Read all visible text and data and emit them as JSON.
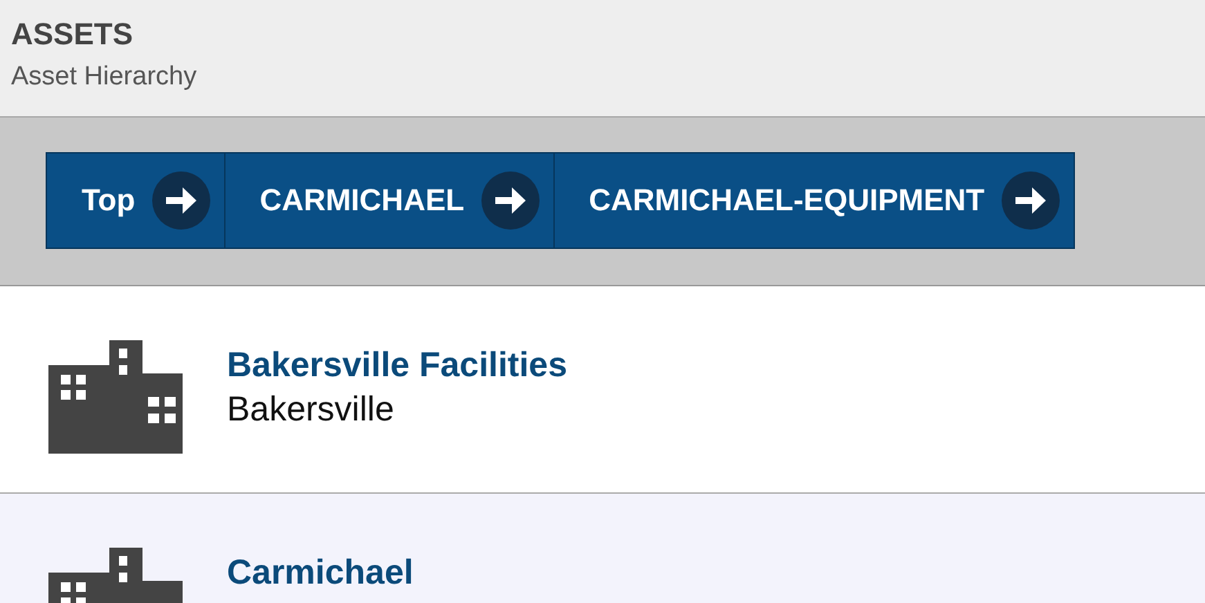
{
  "header": {
    "title": "ASSETS",
    "subtitle": "Asset Hierarchy"
  },
  "breadcrumb": [
    {
      "label": "Top"
    },
    {
      "label": "CARMICHAEL"
    },
    {
      "label": "CARMICHAEL-EQUIPMENT"
    }
  ],
  "assets": [
    {
      "name": "Bakersville Facilities",
      "location": "Bakersville",
      "selected": false
    },
    {
      "name": "Carmichael",
      "selected": true
    }
  ]
}
